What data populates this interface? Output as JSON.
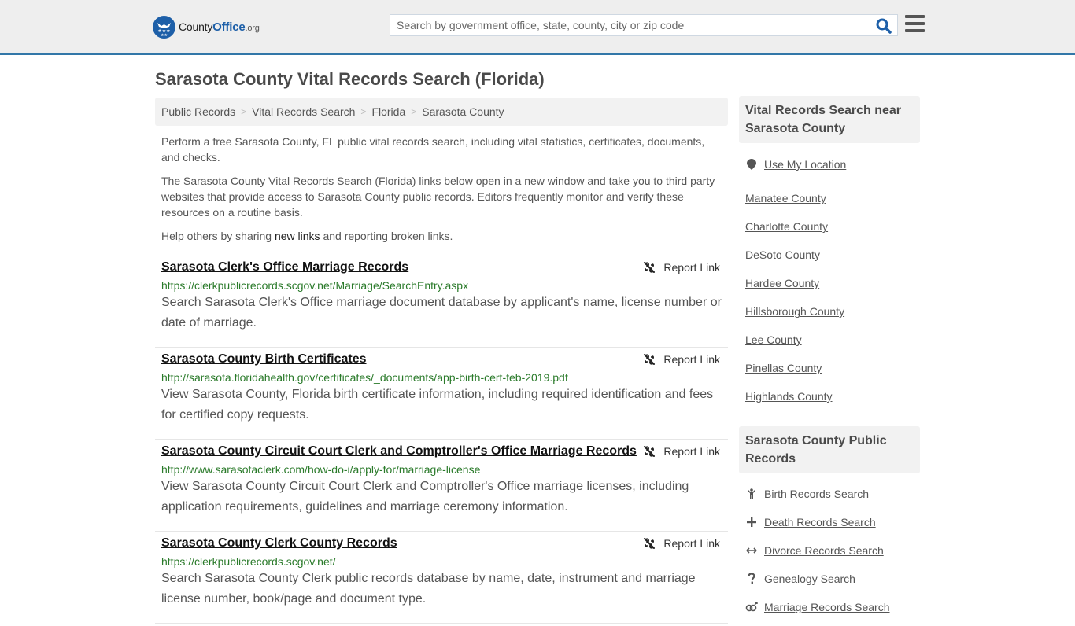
{
  "header": {
    "logo_text_1": "County",
    "logo_text_2": "Office",
    "logo_text_3": ".org",
    "search_placeholder": "Search by government office, state, county, city or zip code",
    "search_value": "",
    "icons": {
      "search": "search-icon",
      "menu": "hamburger-menu-icon",
      "logo": "eagle-stars-logo-icon"
    },
    "colors": {
      "brand": "#1d5fa8",
      "topbar_border": "#3277a8"
    }
  },
  "page": {
    "title": "Sarasota County Vital Records Search (Florida)"
  },
  "breadcrumb": [
    {
      "label": "Public Records"
    },
    {
      "label": "Vital Records Search"
    },
    {
      "label": "Florida"
    },
    {
      "label": "Sarasota County"
    }
  ],
  "breadcrumb_separator": ">",
  "intro": {
    "p1": "Perform a free Sarasota County, FL public vital records search, including vital statistics, certificates, documents, and checks.",
    "p2": "The Sarasota County Vital Records Search (Florida) links below open in a new window and take you to third party websites that provide access to Sarasota County public records. Editors frequently monitor and verify these resources on a routine basis.",
    "p3_before": "Help others by sharing ",
    "p3_link": "new links",
    "p3_after": " and reporting broken links."
  },
  "report_label": "Report Link",
  "results": [
    {
      "title": "Sarasota Clerk's Office Marriage Records",
      "url": "https://clerkpublicrecords.scgov.net/Marriage/SearchEntry.aspx",
      "description": "Search Sarasota Clerk's Office marriage document database by applicant's name, license number or date of marriage."
    },
    {
      "title": "Sarasota County Birth Certificates",
      "url": "http://sarasota.floridahealth.gov/certificates/_documents/app-birth-cert-feb-2019.pdf",
      "description": "View Sarasota County, Florida birth certificate information, including required identification and fees for certified copy requests."
    },
    {
      "title": "Sarasota County Circuit Court Clerk and Comptroller's Office Marriage Records",
      "url": "http://www.sarasotaclerk.com/how-do-i/apply-for/marriage-license",
      "description": "View Sarasota County Circuit Court Clerk and Comptroller's Office marriage licenses, including application requirements, guidelines and marriage ceremony information."
    },
    {
      "title": "Sarasota County Clerk County Records",
      "url": "https://clerkpublicrecords.scgov.net/",
      "description": "Search Sarasota County Clerk public records database by name, date, instrument and marriage license number, book/page and document type."
    }
  ],
  "sidebar": {
    "nearby_heading": "Vital Records Search near Sarasota County",
    "use_location": "Use My Location",
    "nearby": [
      "Manatee County",
      "Charlotte County",
      "DeSoto County",
      "Hardee County",
      "Hillsborough County",
      "Lee County",
      "Pinellas County",
      "Highlands County"
    ],
    "public_heading": "Sarasota County Public Records",
    "public_links": [
      {
        "label": "Birth Records Search",
        "icon": "child-icon"
      },
      {
        "label": "Death Records Search",
        "icon": "plus-icon"
      },
      {
        "label": "Divorce Records Search",
        "icon": "arrows-horizontal-icon"
      },
      {
        "label": "Genealogy Search",
        "icon": "question-icon"
      },
      {
        "label": "Marriage Records Search",
        "icon": "marriage-symbol-icon"
      }
    ]
  }
}
